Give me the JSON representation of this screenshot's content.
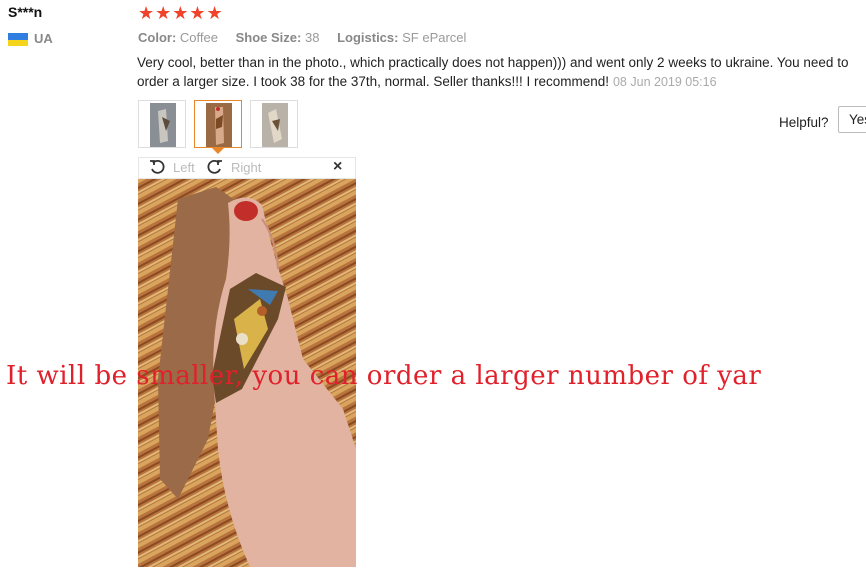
{
  "reviewer": {
    "name": "S***n",
    "country": "UA",
    "rating_stars": "★★★★★",
    "rating": 5
  },
  "attributes": [
    {
      "key": "Color:",
      "value": "Coffee"
    },
    {
      "key": "Shoe Size:",
      "value": "38"
    },
    {
      "key": "Logistics:",
      "value": "SF eParcel"
    }
  ],
  "review": {
    "text": "Very cool, better than in the photo., which practically does not happen))) and went only 2 weeks to ukraine. You need to order a larger size. I took 38 for the 37th, normal. Seller thanks!!! I recommend!",
    "date": "08 Jun 2019 05:16"
  },
  "helpful": {
    "label": "Helpful?",
    "yes_label": "Yes"
  },
  "viewer": {
    "rotate_left_label": "Left",
    "rotate_right_label": "Right",
    "close_symbol": "×"
  },
  "overlay_text": "It will be smaller, you can order a larger number of yar",
  "colors": {
    "star": "#f1432a",
    "active_thumb_border": "#e8862a",
    "overlay_red": "#e0202a"
  }
}
